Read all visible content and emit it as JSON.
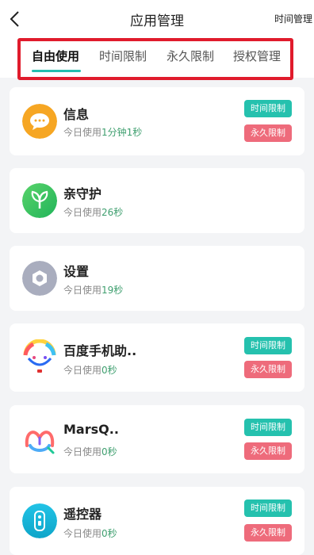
{
  "header": {
    "title": "应用管理",
    "right_action": "时间管理",
    "back_icon": "chevron-left-icon"
  },
  "tabs": [
    {
      "label": "自由使用",
      "active": true
    },
    {
      "label": "时间限制",
      "active": false
    },
    {
      "label": "永久限制",
      "active": false
    },
    {
      "label": "授权管理",
      "active": false
    }
  ],
  "accent_color": "#25c1ae",
  "highlight_color": "#e01b2c",
  "usage_prefix": "今日使用",
  "apps": [
    {
      "name": "信息",
      "usage": "1分钟1秒",
      "icon": "message-icon",
      "buttons": [
        "时间限制",
        "永久限制"
      ]
    },
    {
      "name": "亲守护",
      "usage": "26秒",
      "icon": "sprout-icon",
      "buttons": []
    },
    {
      "name": "设置",
      "usage": "19秒",
      "icon": "settings-hex-icon",
      "buttons": []
    },
    {
      "name": "百度手机助..",
      "usage": "0秒",
      "icon": "baidu-assistant-icon",
      "buttons": [
        "时间限制",
        "永久限制"
      ]
    },
    {
      "name": "MarsQ..",
      "usage": "0秒",
      "icon": "marsq-icon",
      "buttons": [
        "时间限制",
        "永久限制"
      ]
    },
    {
      "name": "遥控器",
      "usage": "0秒",
      "icon": "remote-control-icon",
      "buttons": [
        "时间限制",
        "永久限制"
      ]
    }
  ]
}
